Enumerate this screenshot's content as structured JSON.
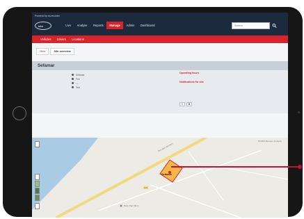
{
  "header": {
    "powered_by": "Powered by  es.recorder",
    "logo_text": "MAN"
  },
  "nav": {
    "items": [
      {
        "label": "Live",
        "active": false
      },
      {
        "label": "Analyse",
        "active": false
      },
      {
        "label": "Reports",
        "active": false
      },
      {
        "label": "Manage",
        "active": true
      },
      {
        "label": "Admin",
        "active": false
      },
      {
        "label": "Dashboard",
        "active": false
      }
    ]
  },
  "search": {
    "placeholder": "Search",
    "icon": "search-icon"
  },
  "subnav": {
    "items": [
      {
        "label": "Vehicles"
      },
      {
        "label": "Drivers"
      },
      {
        "label": "Locations"
      }
    ]
  },
  "tabs": [
    {
      "label": "Sites",
      "active": false
    },
    {
      "label": "Site overview",
      "active": true
    }
  ],
  "site": {
    "title": "Sefamar",
    "details": [
      "Sefamar",
      "Fee",
      "—",
      "Test"
    ],
    "operating_hours": "Operating hours",
    "notifications": "Notifications for site"
  },
  "buttons": {
    "edit": "✎",
    "delete": "✖"
  },
  "map": {
    "road_label": "Rue des Vanniers",
    "corner_label": "STARS Bureaux & Dépôt",
    "bottom_label": "Beau Parc Mont",
    "site_label": "Sefamar",
    "pin_label": "100"
  },
  "colors": {
    "accent": "#d8232a",
    "topbar": "#1b2b3d",
    "pointer": "#c4122a"
  }
}
